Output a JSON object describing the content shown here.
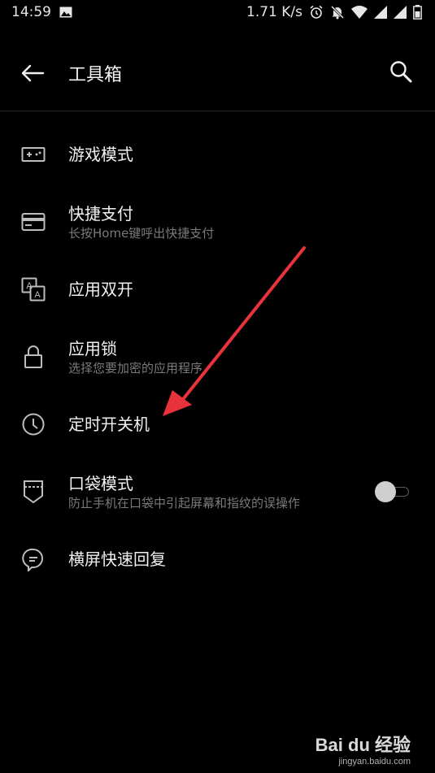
{
  "status_bar": {
    "time": "14:59",
    "net_speed": "1.71 K/s",
    "icons": [
      "image-icon",
      "alarm-icon",
      "mute-icon",
      "wifi-icon",
      "signal-icon",
      "signal-icon",
      "battery-icon"
    ]
  },
  "toolbar": {
    "title": "工具箱",
    "back_icon": "back-arrow-icon",
    "search_icon": "search-icon"
  },
  "items": [
    {
      "title": "游戏模式",
      "subtitle": "",
      "icon": "gamepad-icon"
    },
    {
      "title": "快捷支付",
      "subtitle": "长按Home键呼出快捷支付",
      "icon": "card-icon"
    },
    {
      "title": "应用双开",
      "subtitle": "",
      "icon": "translate-icon"
    },
    {
      "title": "应用锁",
      "subtitle": "选择您要加密的应用程序",
      "icon": "lock-icon"
    },
    {
      "title": "定时开关机",
      "subtitle": "",
      "icon": "clock-icon"
    },
    {
      "title": "口袋模式",
      "subtitle": "防止手机在口袋中引起屏幕和指纹的误操作",
      "icon": "pocket-icon",
      "toggle_on": false
    },
    {
      "title": "横屏快速回复",
      "subtitle": "",
      "icon": "chat-bubble-icon"
    }
  ],
  "watermark": {
    "logo": "Bai du 经验",
    "url": "jingyan.baidu.com"
  },
  "colors": {
    "background": "#000000",
    "title_text": "#f0f0f0",
    "subtitle_text": "#7a7a7a",
    "annotation_arrow": "#e8323c"
  }
}
